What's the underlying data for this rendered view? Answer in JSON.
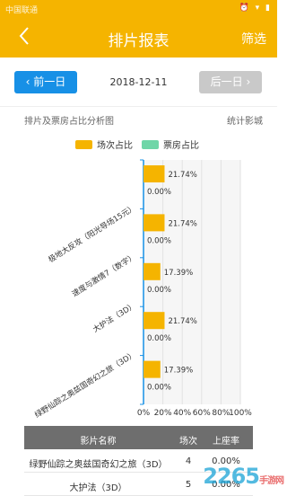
{
  "status_bar": {
    "carrier": "中国联通",
    "icons": "⏰ ▾ ▮"
  },
  "nav": {
    "title": "排片报表",
    "filter": "筛选",
    "back_icon": "chevron-left-icon"
  },
  "date_bar": {
    "prev": "前一日",
    "date": "2018-12-11",
    "next": "后一日"
  },
  "section": {
    "title": "排片及票房占比分析图",
    "cinema": "统计影城"
  },
  "chart_data": {
    "type": "bar",
    "orientation": "horizontal",
    "categories": [
      "极地大反攻（阳光导场15元）",
      "速度与激情7（数字）",
      "大护法（3D）",
      "绿野仙踪之奥兹国奇幻之旅（3D）"
    ],
    "category_labels_shown": [
      "",
      "极地大反攻（阳光导场15元）",
      "速度与激情7（数字）",
      "大护法（3D）",
      "绿野仙踪之奥兹国奇幻之旅（3D）"
    ],
    "series": [
      {
        "name": "场次占比",
        "color": "#f5b400",
        "values": [
          21.74,
          21.74,
          17.39,
          21.74,
          17.39
        ]
      },
      {
        "name": "票房占比",
        "color": "#6fd6a8",
        "values": [
          0,
          0,
          0,
          0,
          0
        ]
      }
    ],
    "value_labels": [
      [
        "21.74%",
        "0.00%"
      ],
      [
        "21.74%",
        "0.00%"
      ],
      [
        "17.39%",
        "0.00%"
      ],
      [
        "21.74%",
        "0.00%"
      ],
      [
        "17.39%",
        "0.00%"
      ]
    ],
    "x_ticks": [
      "0%",
      "20%",
      "40%",
      "60%",
      "80%",
      "100%"
    ],
    "xlim": [
      0,
      100
    ],
    "grid": true,
    "legend": "top"
  },
  "table": {
    "headers": [
      "影片名称",
      "场次",
      "上座率"
    ],
    "rows": [
      [
        "绿野仙踪之奥兹国奇幻之旅（3D）",
        "4",
        "0.00%"
      ],
      [
        "大护法（3D）",
        "5",
        "0.00%"
      ]
    ]
  },
  "watermark": {
    "text": "2265",
    "suffix": "手游网"
  }
}
